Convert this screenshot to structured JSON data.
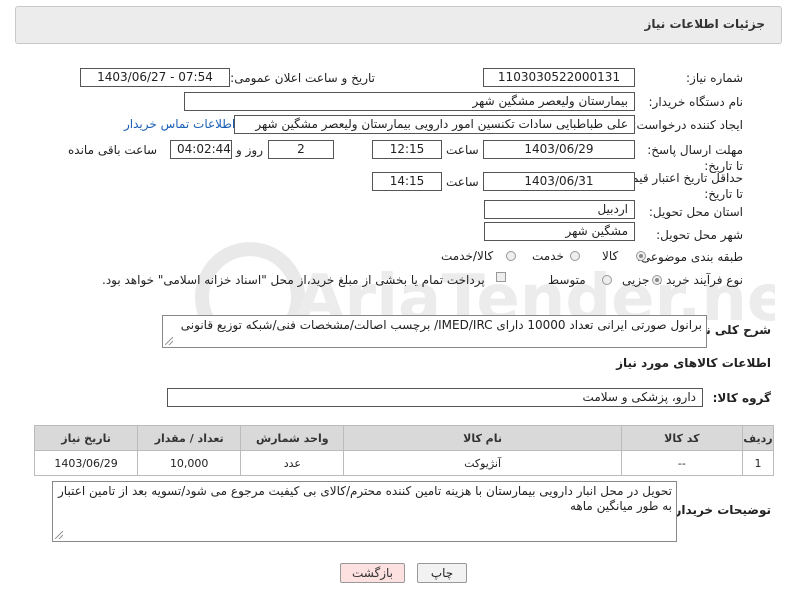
{
  "header": {
    "title": "جزئیات اطلاعات نیاز"
  },
  "fields": {
    "need_number_label": "شماره نیاز:",
    "need_number": "1103030522000131",
    "announce_label": "تاریخ و ساعت اعلان عمومی:",
    "announce_value": "1403/06/27 - 07:54",
    "buyer_org_label": "نام دستگاه خریدار:",
    "buyer_org": "بیمارستان ولیعصر مشگین شهر",
    "creator_label": "ایجاد کننده درخواست:",
    "creator": "علی طباطبایی سادات تکنسین امور دارویی بیمارستان ولیعصر مشگین شهر",
    "contact_link": "اطلاعات تماس خریدار",
    "deadline_label": "مهلت ارسال پاسخ: تا تاریخ:",
    "deadline_date": "1403/06/29",
    "time_label": "ساعت",
    "deadline_time": "12:15",
    "days_value": "2",
    "days_label": "روز و",
    "remaining_time": "04:02:44",
    "remaining_label": "ساعت باقی مانده",
    "validity_label": "حداقل تاریخ اعتبار قیمت: تا تاریخ:",
    "validity_date": "1403/06/31",
    "validity_time": "14:15",
    "province_label": "استان محل تحویل:",
    "province": "اردبیل",
    "city_label": "شهر محل تحویل:",
    "city": "مشگین شهر",
    "category_label": "طبقه بندی موضوعی:",
    "category_options": [
      "کالا",
      "خدمت",
      "کالا/خدمت"
    ],
    "process_label": "نوع فرآیند خرید :",
    "process_options": [
      "جزیی",
      "متوسط"
    ],
    "payment_note": "پرداخت تمام یا بخشی از مبلغ خرید،از محل \"اسناد خزانه اسلامی\" خواهد بود."
  },
  "description": {
    "label": "شرح کلی نیاز:",
    "text": "برانول صورتی ایرانی تعداد 10000 دارای IMED/IRC/ برچسب اصالت/مشخصات فنی/شبکه توزیع قانونی"
  },
  "goods_section": {
    "title": "اطلاعات کالاهای مورد نیاز",
    "group_label": "گروه کالا:",
    "group_value": "دارو، پزشکی و سلامت"
  },
  "table": {
    "headers": [
      "ردیف",
      "کد کالا",
      "نام کالا",
      "واحد شمارش",
      "تعداد / مقدار",
      "تاریخ نیاز"
    ],
    "rows": [
      [
        "1",
        "--",
        "آنژیوکت",
        "عدد",
        "10,000",
        "1403/06/29"
      ]
    ]
  },
  "buyer_notes": {
    "label": "توضیحات خریدار:",
    "text": "تحویل در محل انبار دارویی بیمارستان با هزینه تامین کننده محترم/کالای بی کیفیت مرجوع می شود/تسویه بعد از تامین اعتبار به طور میانگین ماهه"
  },
  "buttons": {
    "print": "چاپ",
    "back": "بازگشت"
  },
  "watermark": {
    "text": "AriaTender.neT"
  },
  "colors": {
    "link": "#1a5fb4",
    "back_button_bg": "#fde0e0",
    "header_bg": "#ececec",
    "table_header_bg": "#d9d9d9"
  }
}
